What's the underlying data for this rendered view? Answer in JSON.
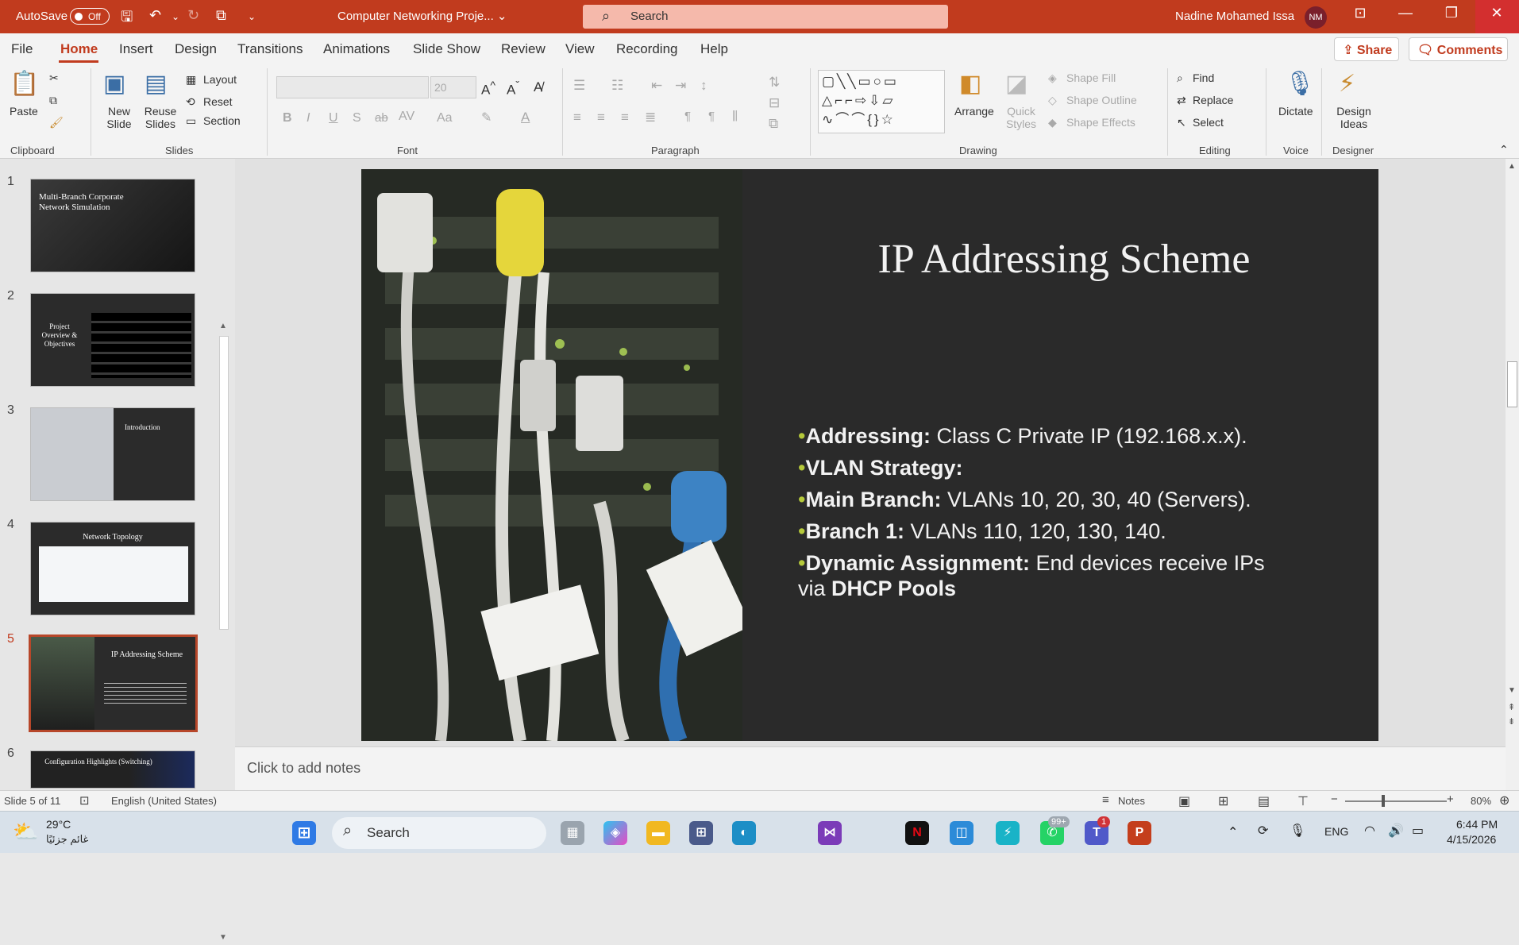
{
  "titlebar": {
    "autosave_label": "AutoSave",
    "autosave_state": "Off",
    "document_title": "Computer Networking Proje...",
    "search_placeholder": "Search",
    "user_name": "Nadine Mohamed Issa",
    "user_initials": "NM"
  },
  "menu": {
    "tabs": [
      "File",
      "Home",
      "Insert",
      "Design",
      "Transitions",
      "Animations",
      "Slide Show",
      "Review",
      "View",
      "Recording",
      "Help"
    ],
    "active_tab": "Home",
    "share_label": "Share",
    "comments_label": "Comments"
  },
  "ribbon": {
    "clipboard": {
      "paste": "Paste",
      "group": "Clipboard"
    },
    "slides": {
      "new_slide": "New Slide",
      "reuse_slides": "Reuse Slides",
      "layout": "Layout",
      "reset": "Reset",
      "section": "Section",
      "group": "Slides"
    },
    "font": {
      "size_value": "20",
      "group": "Font"
    },
    "paragraph": {
      "group": "Paragraph"
    },
    "drawing": {
      "arrange": "Arrange",
      "quick_styles": "Quick Styles",
      "shape_fill": "Shape Fill",
      "shape_outline": "Shape Outline",
      "shape_effects": "Shape Effects",
      "group": "Drawing"
    },
    "editing": {
      "find": "Find",
      "replace": "Replace",
      "select": "Select",
      "group": "Editing"
    },
    "voice": {
      "dictate": "Dictate",
      "group": "Voice"
    },
    "designer": {
      "design_ideas": "Design Ideas",
      "group": "Designer"
    }
  },
  "thumbnails": [
    {
      "num": "1",
      "title": "Multi-Branch Corporate Network Simulation"
    },
    {
      "num": "2",
      "title": "Project Overview & Objectives"
    },
    {
      "num": "3",
      "title": "Introduction"
    },
    {
      "num": "4",
      "title": "Network Topology"
    },
    {
      "num": "5",
      "title": "IP Addressing Scheme"
    },
    {
      "num": "6",
      "title": "Configuration Highlights (Switching)"
    }
  ],
  "slide": {
    "title": "IP Addressing Scheme",
    "bullets": [
      {
        "bold": "Addressing:",
        "text": " Class C Private IP (192.168.x.x)."
      },
      {
        "bold": "VLAN Strategy:",
        "text": ""
      },
      {
        "bold": "Main Branch:",
        "text": " VLANs 10, 20, 30, 40 (Servers)."
      },
      {
        "bold": "Branch 1:",
        "text": " VLANs 110, 120, 130, 140."
      },
      {
        "bold": "Dynamic Assignment:",
        "text": " End devices receive IPs via ",
        "bold2": "DHCP Pools"
      }
    ]
  },
  "notes_placeholder": "Click to add notes",
  "status": {
    "slide_info": "Slide 5 of 11",
    "language": "English (United States)",
    "notes_label": "Notes",
    "zoom": "80%"
  },
  "taskbar": {
    "weather_temp": "29°C",
    "weather_desc": "غائم جزئيًا",
    "search_label": "Search",
    "badge_whatsapp": "99+",
    "badge_teams": "1",
    "lang": "ENG",
    "time": "6:44 PM",
    "date": "4/15/2026"
  }
}
